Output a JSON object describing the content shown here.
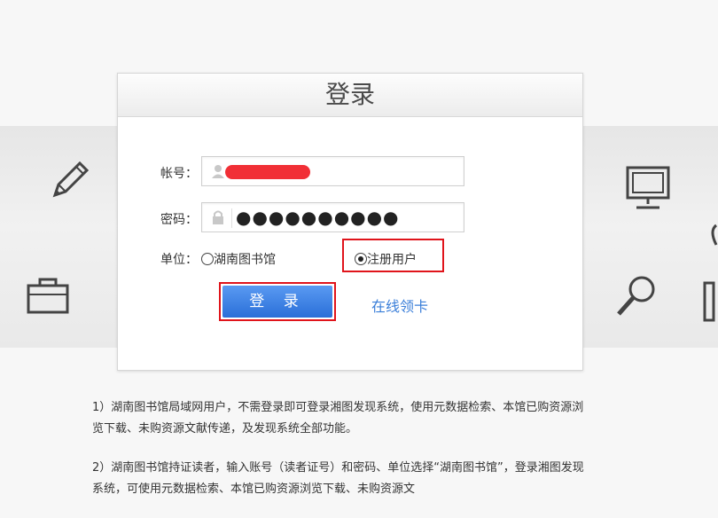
{
  "login_panel": {
    "title": "登录",
    "account_label": "帐号：",
    "password_label": "密码：",
    "password_value": "●●●●●●●●●●",
    "unit_label": "单位：",
    "unit_options": [
      {
        "label": "湖南图书馆",
        "checked": false
      },
      {
        "label": "注册用户",
        "checked": true
      }
    ],
    "login_button": "登 录",
    "online_card_link": "在线领卡"
  },
  "notes": [
    "1）湖南图书馆局域网用户，不需登录即可登录湘图发现系统，使用元数据检索、本馆已购资源浏览下载、未购资源文献传递，及发现系统全部功能。",
    "2）湖南图书馆持证读者，输入账号（读者证号）和密码、单位选择“湖南图书馆”，登录湘图发现系统，可使用元数据检索、本馆已购资源浏览下载、未购资源文"
  ],
  "colors": {
    "highlight": "#e0141b",
    "button": "#2a6fd8",
    "link": "#3b7fd9"
  }
}
